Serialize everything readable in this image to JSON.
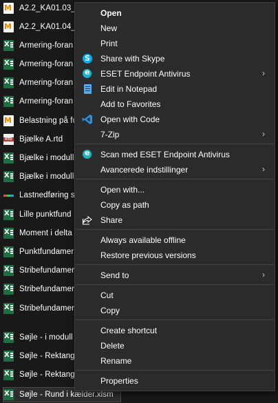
{
  "files": [
    {
      "name": "A2.2_KA01.03_B",
      "icon": "mathcad-icon",
      "selected": false
    },
    {
      "name": "A2.2_KA01.04_B",
      "icon": "mathcad-icon",
      "selected": false
    },
    {
      "name": "Armering-foran",
      "icon": "excel-icon",
      "selected": false
    },
    {
      "name": "Armering-foran",
      "icon": "excel-icon",
      "selected": false
    },
    {
      "name": "Armering-foran",
      "icon": "excel-icon",
      "selected": false
    },
    {
      "name": "Armering-foran",
      "icon": "excel-icon",
      "selected": false
    },
    {
      "name": "Belastning på fu",
      "icon": "mathcad-icon",
      "selected": false
    },
    {
      "name": "Bjælke A.rtd",
      "icon": "rtd-icon",
      "selected": false
    },
    {
      "name": "Bjælke i modull",
      "icon": "excel-icon",
      "selected": false
    },
    {
      "name": "Bjælke i modull",
      "icon": "excel-icon",
      "selected": false
    },
    {
      "name": "Lastnedføring s",
      "icon": "load-icon",
      "selected": false
    },
    {
      "name": "Lille punktfund",
      "icon": "excel-icon",
      "selected": false
    },
    {
      "name": "Moment i delta",
      "icon": "excel-icon",
      "selected": false
    },
    {
      "name": "Punktfundamer",
      "icon": "excel-icon",
      "selected": false
    },
    {
      "name": "Stribefundamer",
      "icon": "excel-icon",
      "selected": false
    },
    {
      "name": "Stribefundamer",
      "icon": "excel-icon",
      "selected": false
    },
    {
      "name": "Stribefundamer",
      "icon": "excel-icon",
      "selected": false
    },
    {
      "name": "Søjle - i modull",
      "icon": "excel-icon",
      "selected": false
    },
    {
      "name": "Søjle - Rektangu",
      "icon": "excel-icon",
      "selected": false
    },
    {
      "name": "Søjle - Rektangu",
      "icon": "excel-icon",
      "selected": false
    },
    {
      "name": "Søjle - Rund i kælder.xlsm",
      "icon": "excel-icon",
      "selected": true
    }
  ],
  "menu": {
    "open": "Open",
    "new": "New",
    "print": "Print",
    "share_skype": "Share with Skype",
    "eset": "ESET Endpoint Antivirus",
    "edit_notepad": "Edit in Notepad",
    "add_favorites": "Add to Favorites",
    "open_code": "Open with Code",
    "zip": "7-Zip",
    "scan_eset": "Scan med ESET Endpoint Antivirus",
    "advanced": "Avancerede indstillinger",
    "open_with": "Open with...",
    "copy_path": "Copy as path",
    "share": "Share",
    "offline": "Always available offline",
    "restore": "Restore previous versions",
    "send_to": "Send to",
    "cut": "Cut",
    "copy": "Copy",
    "create_shortcut": "Create shortcut",
    "delete": "Delete",
    "rename": "Rename",
    "properties": "Properties",
    "submenu_arrow": "›"
  },
  "colors": {
    "background": "#191919",
    "menu_bg": "#2b2b2b",
    "excel_green": "#1d6f42",
    "skype_blue": "#00aff0",
    "eset_teal": "#1bb3c6",
    "vscode_blue": "#2b8fe0"
  }
}
